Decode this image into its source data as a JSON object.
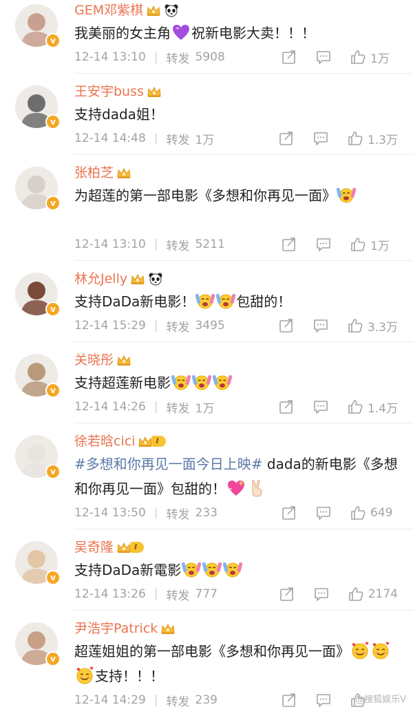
{
  "comments": [
    {
      "name": "GEM邓紫棋",
      "badge": "crown-panda",
      "text_parts": [
        {
          "t": "我美丽的女主角",
          "k": "text"
        },
        {
          "t": "purple-heart-emoji",
          "k": "emoji"
        },
        {
          "t": "祝新电影大卖！！！",
          "k": "text"
        }
      ],
      "time": "12-14 13:10",
      "forward_label": "转发",
      "forward_count": "5908",
      "likes": "1万",
      "avatar_color": "#c9a090"
    },
    {
      "name": "王安宇buss",
      "badge": "crown",
      "text_parts": [
        {
          "t": "支持dada姐！",
          "k": "text"
        }
      ],
      "time": "12-14 14:48",
      "forward_label": "转发",
      "forward_count": "1万",
      "likes": "1.3万",
      "avatar_color": "#6e6e6e"
    },
    {
      "name": "张柏芝",
      "badge": "crown",
      "text_parts": [
        {
          "t": "为超莲的第一部电影《多想和你再见一面》",
          "k": "text"
        },
        {
          "t": "cheering-emoji",
          "k": "emoji"
        }
      ],
      "time": "12-14 13:10",
      "forward_label": "转发",
      "forward_count": "5211",
      "likes": "1万",
      "avatar_color": "#d8d0c8"
    },
    {
      "name": "林允Jelly",
      "badge": "crown-panda",
      "text_parts": [
        {
          "t": "支持DaDa新电影！",
          "k": "text"
        },
        {
          "t": "cheering-emoji",
          "k": "emoji"
        },
        {
          "t": "cheering-emoji",
          "k": "emoji"
        },
        {
          "t": "包甜的！",
          "k": "text"
        }
      ],
      "time": "12-14 15:29",
      "forward_label": "转发",
      "forward_count": "3495",
      "likes": "3.3万",
      "avatar_color": "#7a4a3a"
    },
    {
      "name": "关晓彤",
      "badge": "crown",
      "text_parts": [
        {
          "t": "支持超莲新电影",
          "k": "text"
        },
        {
          "t": "cheering-emoji",
          "k": "emoji"
        },
        {
          "t": "cheering-emoji",
          "k": "emoji"
        },
        {
          "t": "cheering-emoji",
          "k": "emoji"
        }
      ],
      "time": "12-14 14:26",
      "forward_label": "转发",
      "forward_count": "1万",
      "likes": "1.4万",
      "avatar_color": "#b89a7a"
    },
    {
      "name": "徐若晗cici",
      "badge": "vip",
      "vip_text": "I",
      "text_parts": [
        {
          "t": "#多想和你再见一面今日上映#",
          "k": "hashtag"
        },
        {
          "t": " dada的新电影《多想和你再见一面》包甜的！",
          "k": "text"
        },
        {
          "t": "sparkling-heart-emoji",
          "k": "emoji"
        },
        {
          "t": "victory-hand-emoji",
          "k": "emoji"
        }
      ],
      "time": "12-14 13:50",
      "forward_label": "转发",
      "forward_count": "233",
      "likes": "649",
      "avatar_color": "#e9e4de"
    },
    {
      "name": "吴奇隆",
      "badge": "vip",
      "vip_text": "I",
      "text_parts": [
        {
          "t": "支持DaDa新電影",
          "k": "text"
        },
        {
          "t": "cheering-emoji",
          "k": "emoji"
        },
        {
          "t": "cheering-emoji",
          "k": "emoji"
        },
        {
          "t": "cheering-emoji",
          "k": "emoji"
        }
      ],
      "time": "12-14 13:26",
      "forward_label": "转发",
      "forward_count": "777",
      "likes": "2174",
      "avatar_color": "#e2c6a6"
    },
    {
      "name": "尹浩宇Patrick",
      "badge": "crown",
      "text_parts": [
        {
          "t": "超莲姐姐的第一部电影《多想和你再见一面》",
          "k": "text"
        },
        {
          "t": "smiling-hearts-emoji",
          "k": "emoji"
        },
        {
          "t": "smiling-hearts-emoji",
          "k": "emoji"
        },
        {
          "t": "smiling-hearts-emoji",
          "k": "emoji"
        },
        {
          "t": "支持！！！",
          "k": "text"
        }
      ],
      "time": "12-14 14:29",
      "forward_label": "转发",
      "forward_count": "239",
      "likes": "",
      "avatar_color": "#c8a086"
    }
  ],
  "verified_mark": "v",
  "watermark": "@搜狐娱乐V",
  "colors": {
    "name": "#eb7350",
    "meta": "#a3a3a3",
    "hashtag": "#5b79a8",
    "badge": "#f6a623"
  }
}
